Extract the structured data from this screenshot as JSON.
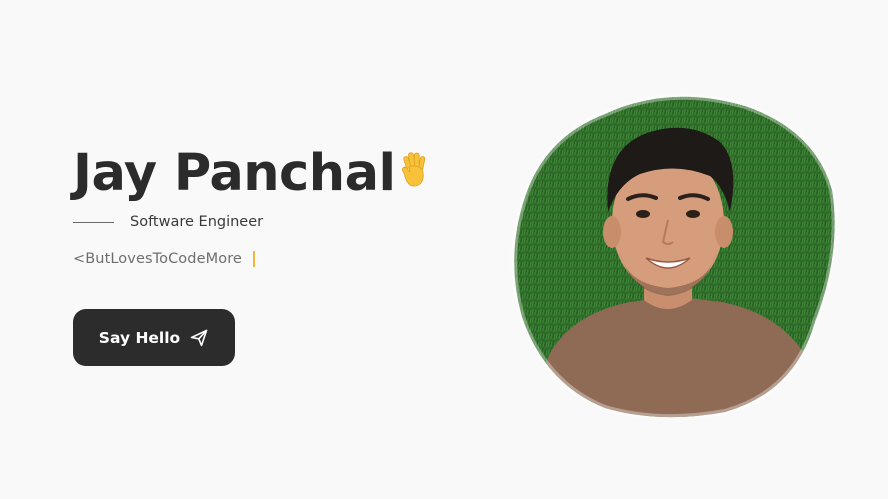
{
  "hero": {
    "name": "Jay Panchal",
    "wave_icon": "waving-hand-icon",
    "subtitle": "Software Engineer",
    "typing_text": "<ButLovesToCodeMore",
    "cta_label": "Say Hello",
    "cta_icon": "send-icon"
  },
  "colors": {
    "background": "#f9f9f9",
    "text_dark": "#2b2b2b",
    "button_bg": "#2c2c2c",
    "caret": "#f0b73e",
    "grass": "#2f6b2a",
    "shirt": "#8f6a55"
  }
}
